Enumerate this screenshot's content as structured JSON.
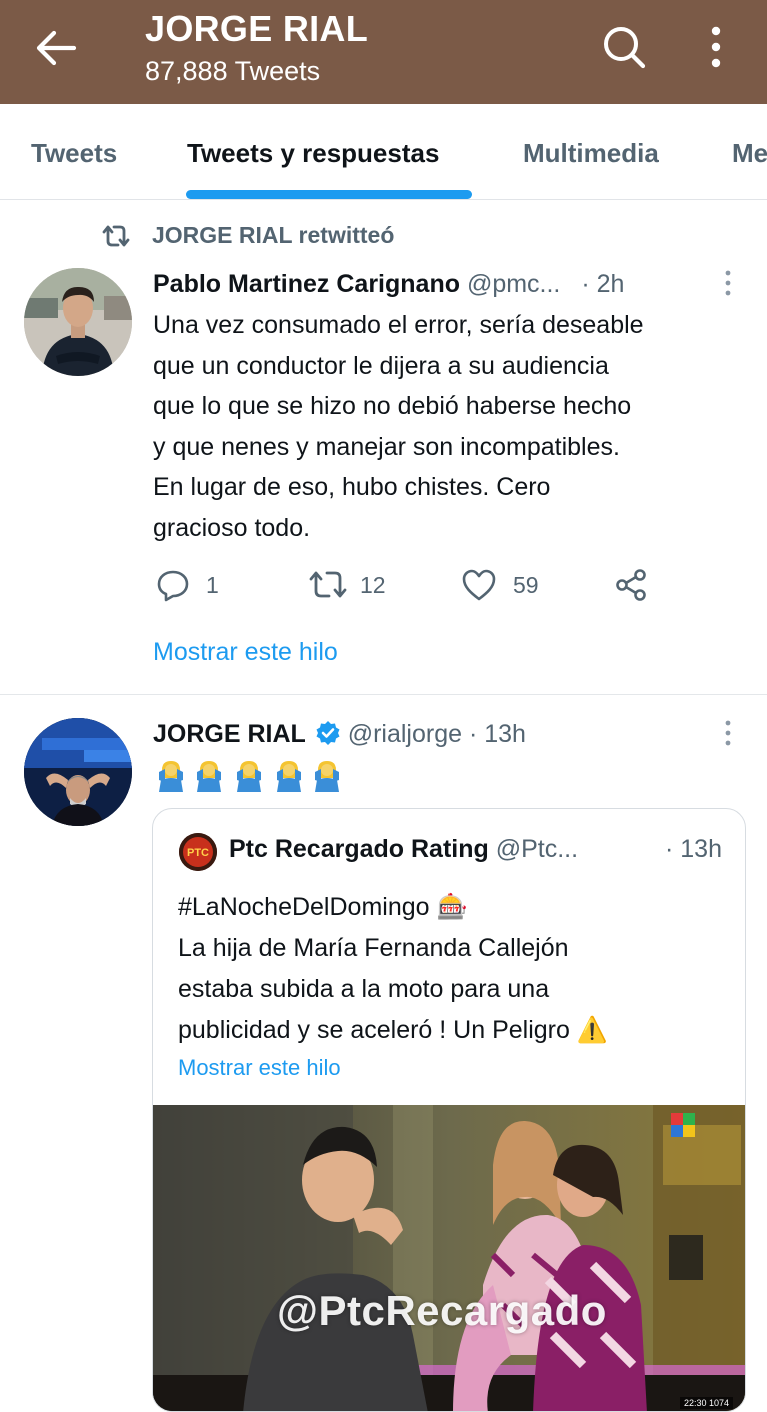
{
  "header": {
    "title": "JORGE RIAL",
    "subtitle": "87,888 Tweets",
    "bg_color": "#7b5a47"
  },
  "tabs": [
    {
      "label": "Tweets",
      "active": false
    },
    {
      "label": "Tweets y respuestas",
      "active": true
    },
    {
      "label": "Multimedia",
      "active": false
    },
    {
      "label": "Me",
      "active": false
    }
  ],
  "tweet1": {
    "retweet_user": "JORGE RIAL",
    "retweet_verb": "retwitteó",
    "author": "Pablo Martinez Carignano",
    "handle": "@pmc...",
    "time": "· 2h",
    "text": "Una vez consumado el error, sería deseable\nque un conductor le dijera a su audiencia\nque lo que se hizo no debió haberse hecho\ny que nenes y manejar son incompatibles.\nEn lugar de eso, hubo chistes. Cero\ngracioso todo.",
    "replies": "1",
    "retweets": "12",
    "likes": "59",
    "show_thread": "Mostrar este hilo"
  },
  "tweet2": {
    "author": "JORGE RIAL",
    "handle": "@rialjorge",
    "time": "· 13h",
    "verified": true,
    "emoji_count": 5,
    "quote": {
      "author": "Ptc Recargado Rating",
      "handle": "@Ptc...",
      "time": "· 13h",
      "logo_text": "PTC",
      "text": "#LaNocheDelDomingo 🎰\nLa hija de María Fernanda Callejón\nestaba subida a la moto para una\npublicidad y se aceleró ! Un Peligro ⚠️",
      "show_thread": "Mostrar este hilo",
      "media_watermark": "@PtcRecargado",
      "media_timestamp": "22:30 1074"
    }
  },
  "colors": {
    "accent": "#1d9bf0",
    "secondary_text": "#536471"
  }
}
